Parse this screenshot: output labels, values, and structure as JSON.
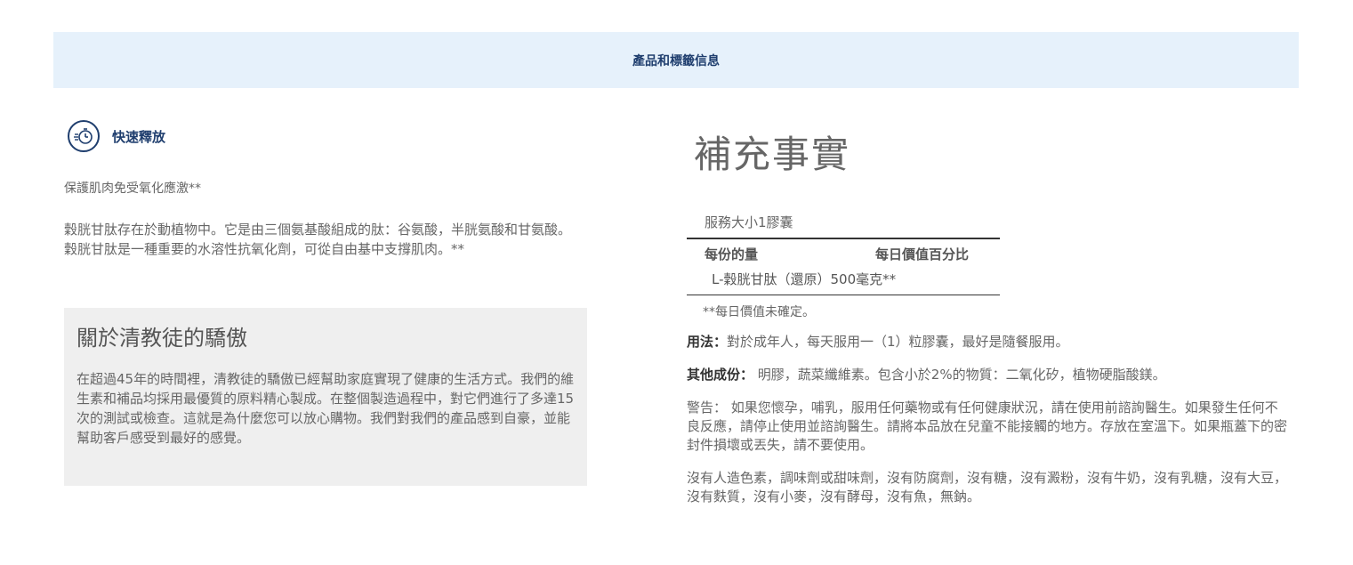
{
  "banner": {
    "title": "產品和標籤信息"
  },
  "badge": {
    "label": "快速釋放",
    "icon": "fast-release-stopwatch-icon"
  },
  "left": {
    "tagline": "保護肌肉免受氧化應激**",
    "description": "穀胱甘肽存在於動植物中。它是由三個氨基酸組成的肽：谷氨酸，半胱氨酸和甘氨酸。穀胱甘肽是一種重要的水溶性抗氧化劑，可從自由基中支撐肌肉。**"
  },
  "pride": {
    "heading": "關於清教徒的驕傲",
    "body": "在超過45年的時間裡，清教徒的驕傲已經幫助家庭實現了健康的生活方式。我們的維生素和補品均採用最優質的原料精心製成。在整個製造過程中，對它們進行了多達15次的測試或檢查。這就是為什麼您可以放心購物。我們對我們的產品感到自豪，並能幫助客戶感受到最好的感覺。"
  },
  "facts": {
    "title": "補充事實",
    "serving_size": "服務大小1膠囊",
    "col_amount": "每份的量",
    "col_dv": "每日價值百分比",
    "row": "L-穀胱甘肽（還原）500毫克**",
    "note": "**每日價值未確定。"
  },
  "directions": {
    "label": "用法：",
    "text": "對於成年人，每天服用一（1）粒膠囊，最好是隨餐服用。"
  },
  "other": {
    "label": "其他成份：",
    "text": " 明膠，蔬菜纖維素。包含小於2%的物質：二氧化矽，植物硬脂酸鎂。"
  },
  "warning": "警告： 如果您懷孕，哺乳，服用任何藥物或有任何健康狀況，請在使用前諮詢醫生。如果發生任何不良反應，請停止使用並諮詢醫生。請將本品放在兒童不能接觸的地方。存放在室溫下。如果瓶蓋下的密封件損壞或丟失，請不要使用。",
  "free_from": "沒有人造色素，調味劑或甜味劑，沒有防腐劑，沒有糖，沒有澱粉，沒有牛奶，沒有乳糖，沒有大豆，沒有麩質，沒有小麥，沒有酵母，沒有魚，無鈉。",
  "colors": {
    "banner_bg": "#e6f1fb",
    "brand_navy": "#1f3e6e",
    "panel_bg": "#efefef"
  }
}
